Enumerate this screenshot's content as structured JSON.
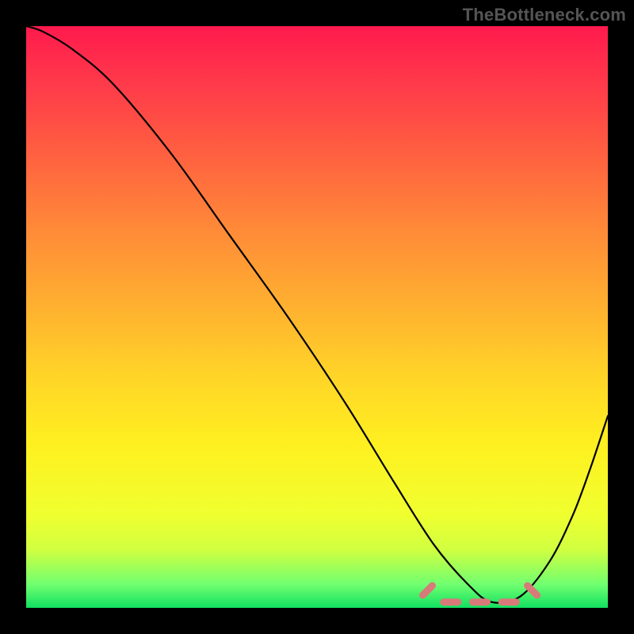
{
  "attribution": "TheBottleneck.com",
  "chart_data": {
    "type": "line",
    "title": "",
    "xlabel": "",
    "ylabel": "",
    "xlim": [
      0,
      100
    ],
    "ylim": [
      0,
      100
    ],
    "grid": false,
    "legend": false,
    "background": "heatmap-gradient",
    "gradient_stops": [
      {
        "pos": 0.0,
        "color": "#ff1a4d"
      },
      {
        "pos": 0.5,
        "color": "#ffc028"
      },
      {
        "pos": 0.85,
        "color": "#f0ff30"
      },
      {
        "pos": 1.0,
        "color": "#10e060"
      }
    ],
    "series": [
      {
        "name": "bottleneck-curve",
        "x": [
          0,
          3,
          8,
          15,
          25,
          35,
          45,
          55,
          63,
          70,
          76,
          80,
          85,
          90,
          94,
          97,
          100
        ],
        "values": [
          100,
          99,
          96,
          90,
          78,
          64,
          50,
          35,
          22,
          11,
          4,
          1,
          2,
          8,
          16,
          24,
          33
        ]
      }
    ],
    "flat_region": {
      "x_start": 69,
      "x_end": 87,
      "y": 1
    },
    "marker_points": [
      {
        "x": 69,
        "y": 3
      },
      {
        "x": 73,
        "y": 1
      },
      {
        "x": 78,
        "y": 1
      },
      {
        "x": 83,
        "y": 1
      },
      {
        "x": 87,
        "y": 3
      }
    ]
  }
}
